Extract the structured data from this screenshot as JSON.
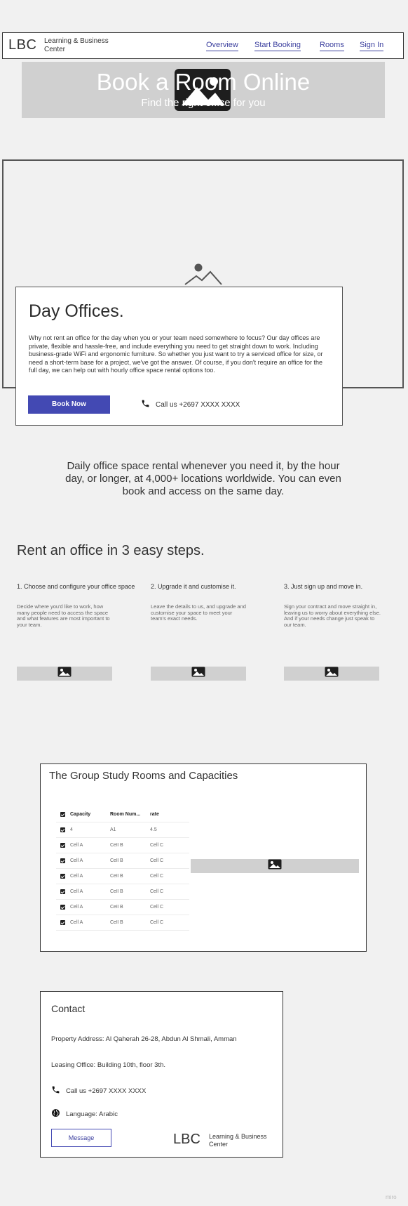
{
  "header": {
    "logo": "LBC",
    "logo_sub": "Learning & Business Center",
    "nav": [
      "Overview",
      "Start Booking",
      "Rooms",
      "Sign In"
    ]
  },
  "hero": {
    "title": "Book a Room Online",
    "subtitle": "Find the right office for you"
  },
  "day_offices": {
    "title": "Day Offices.",
    "body": "Why not rent an office for the day when you or your team need somewhere to focus? Our day offices are private, flexible and hassle-free, and include everything you need to get straight down to work. Including business-grade WiFi and ergonomic furniture. So whether you just want to try a serviced office for size, or need a short-term base for a project, we've got the answer. Of course, if you don't require an office for the full day, we can help out with hourly office space rental options too.",
    "book_button": "Book Now",
    "call": "Call us +2697 XXXX XXXX"
  },
  "intro": "Daily office space rental whenever you need it, by the hour day, or longer, at 4,000+ locations worldwide. You can even book and access on the same day.",
  "steps": {
    "title": "Rent an office in 3 easy steps.",
    "items": [
      {
        "heading": "1. Choose and configure your office space",
        "text": "Decide where you'd like to work, how many people need to access the space and what features are most important to your team."
      },
      {
        "heading": "2. Upgrade it and customise it.",
        "text": "Leave the details to us, and upgrade and customise your space to meet your team's exact needs."
      },
      {
        "heading": "3. Just sign up and move in.",
        "text": "Sign your contract and move straight in, leaving us to worry about everything else. And if your needs change just speak to our team."
      }
    ]
  },
  "rooms": {
    "title": "The Group Study Rooms and Capacities",
    "columns": [
      "Capacity",
      "Room Num...",
      "rate"
    ],
    "rows": [
      [
        "4",
        "A1",
        "4.5"
      ],
      [
        "Cell A",
        "Cell B",
        "Cell C"
      ],
      [
        "Cell A",
        "Cell B",
        "Cell C"
      ],
      [
        "Cell A",
        "Cell B",
        "Cell C"
      ],
      [
        "Cell A",
        "Cell B",
        "Cell C"
      ],
      [
        "Cell A",
        "Cell B",
        "Cell C"
      ],
      [
        "Cell A",
        "Cell B",
        "Cell C"
      ]
    ]
  },
  "contact": {
    "title": "Contact",
    "address": "Property Address: Al Qaherah 26-28, Abdun Al Shmali, Amman",
    "leasing": "Leasing Office: Building 10th, floor 3th.",
    "call": "Call us +2697 XXXX XXXX",
    "language": "Language: Arabic",
    "message_button": "Message",
    "logo": "LBC",
    "logo_sub": "Learning & Business Center"
  },
  "watermark": "miro",
  "colors": {
    "accent": "#4349b3",
    "placeholder": "#d0d0d0"
  }
}
